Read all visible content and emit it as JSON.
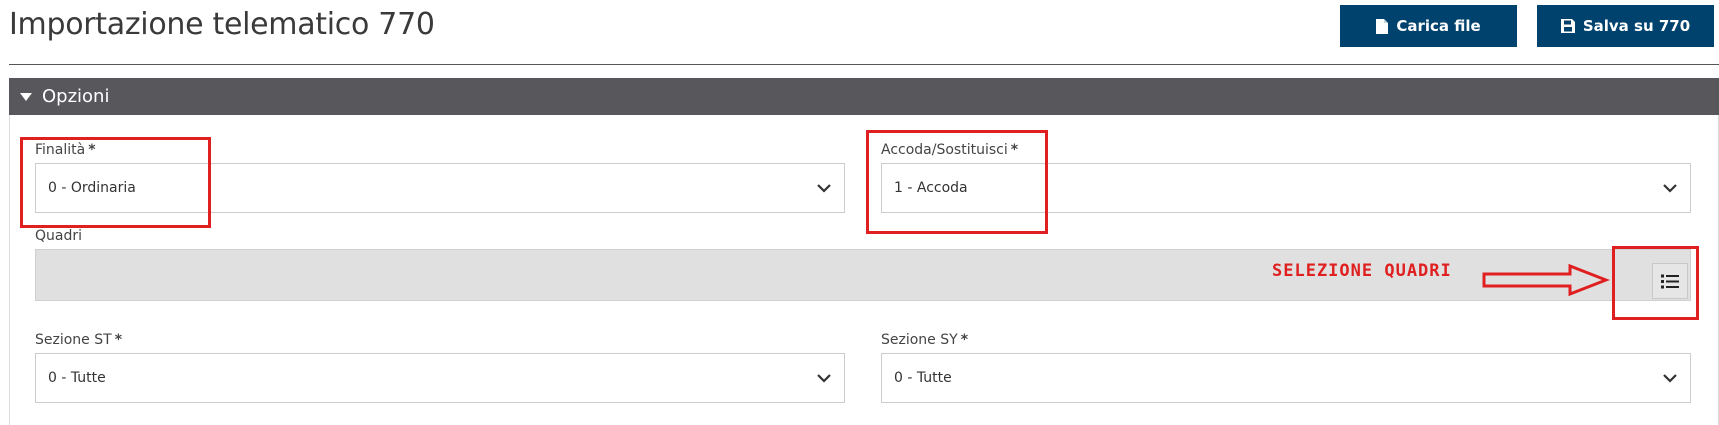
{
  "header": {
    "title": "Importazione telematico 770",
    "buttons": [
      {
        "label": "Carica file",
        "icon": "file-icon"
      },
      {
        "label": "Salva su 770",
        "icon": "save-icon"
      }
    ]
  },
  "section": {
    "title": "Opzioni"
  },
  "fields": {
    "finalita": {
      "label": "Finalità",
      "required": "*",
      "value": "0 - Ordinaria"
    },
    "accoda": {
      "label": "Accoda/Sostituisci",
      "required": "*",
      "value": "1 - Accoda"
    },
    "quadri": {
      "label": "Quadri",
      "button_icon": "list-icon"
    },
    "sezione_st": {
      "label": "Sezione ST",
      "required": "*",
      "value": "0 - Tutte"
    },
    "sezione_sy": {
      "label": "Sezione SY",
      "required": "*",
      "value": "0 - Tutte"
    }
  },
  "annotation": {
    "text": "SELEZIONE QUADRI",
    "color": "#e02020"
  },
  "colors": {
    "primary_button": "#00426e",
    "section_bar": "#58575c"
  }
}
